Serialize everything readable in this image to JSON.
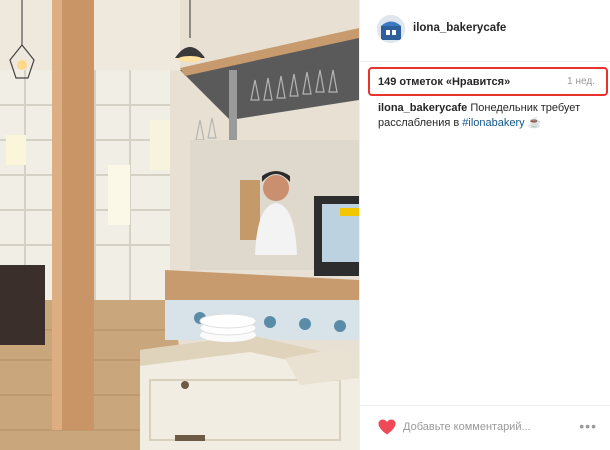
{
  "post": {
    "username": "ilona_bakerycafe",
    "likes_text": "149 отметок «Нравится»",
    "time_ago": "1 нед.",
    "caption_user": "ilona_bakerycafe",
    "caption_text": "Понедельник требует расслабления в",
    "caption_hashtag": "#ilonabakery",
    "caption_emoji": "☕"
  },
  "comment": {
    "placeholder": "Добавьте комментарий..."
  },
  "icons": {
    "like": "heart-icon",
    "more": "more-options-icon",
    "avatar": "profile-avatar"
  },
  "colors": {
    "highlight": "#e8322d",
    "heart": "#ed4956",
    "hashtag": "#125688"
  }
}
